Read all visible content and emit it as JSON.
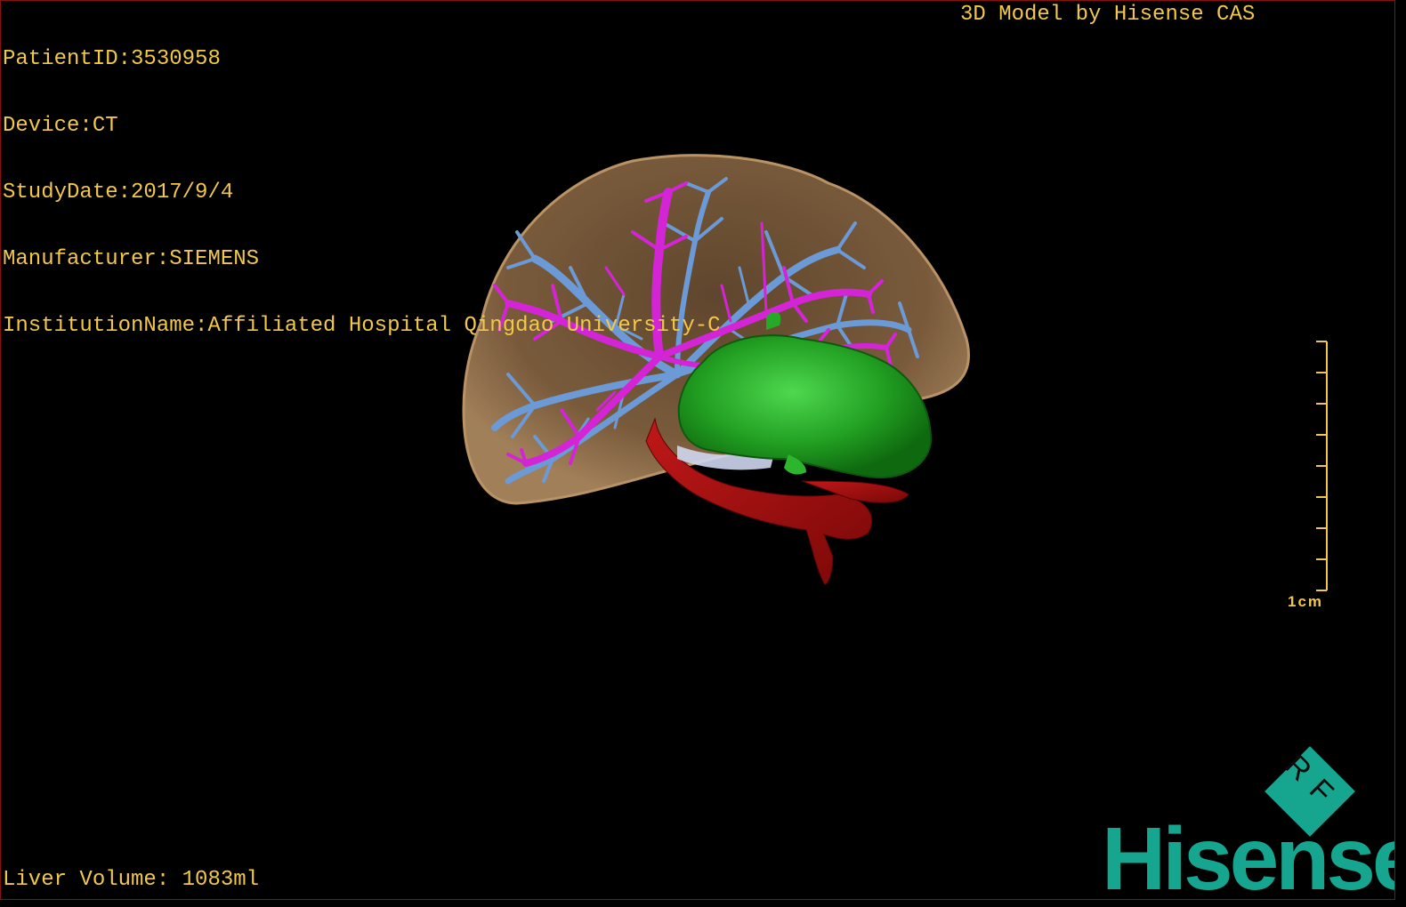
{
  "meta": {
    "patient_id": "PatientID:3530958",
    "device": "Device:CT",
    "study_date": "StudyDate:2017/9/4",
    "manufacturer": "Manufacturer:SIEMENS",
    "institution": "InstitutionName:Affiliated Hospital Qingdao University-C"
  },
  "credit": "3D Model by Hisense CAS",
  "liver_volume": "Liver Volume: 1083ml",
  "scale": {
    "label": "1cm",
    "ticks": 9
  },
  "logo": {
    "badge_text": "RF",
    "brand_text": "Hisense"
  },
  "colors": {
    "overlay_text": "#f2c84a",
    "liver": "#a67c52",
    "portal_vein": "#d324d6",
    "hepatic_vein": "#6b9ad6",
    "gallbladder": "#27a827",
    "artery": "#b01010",
    "brand": "#16a58f",
    "border": "#8a1010"
  },
  "icons": {
    "logo_badge": "rf-diamond-icon",
    "scale": "scale-bar-icon"
  }
}
